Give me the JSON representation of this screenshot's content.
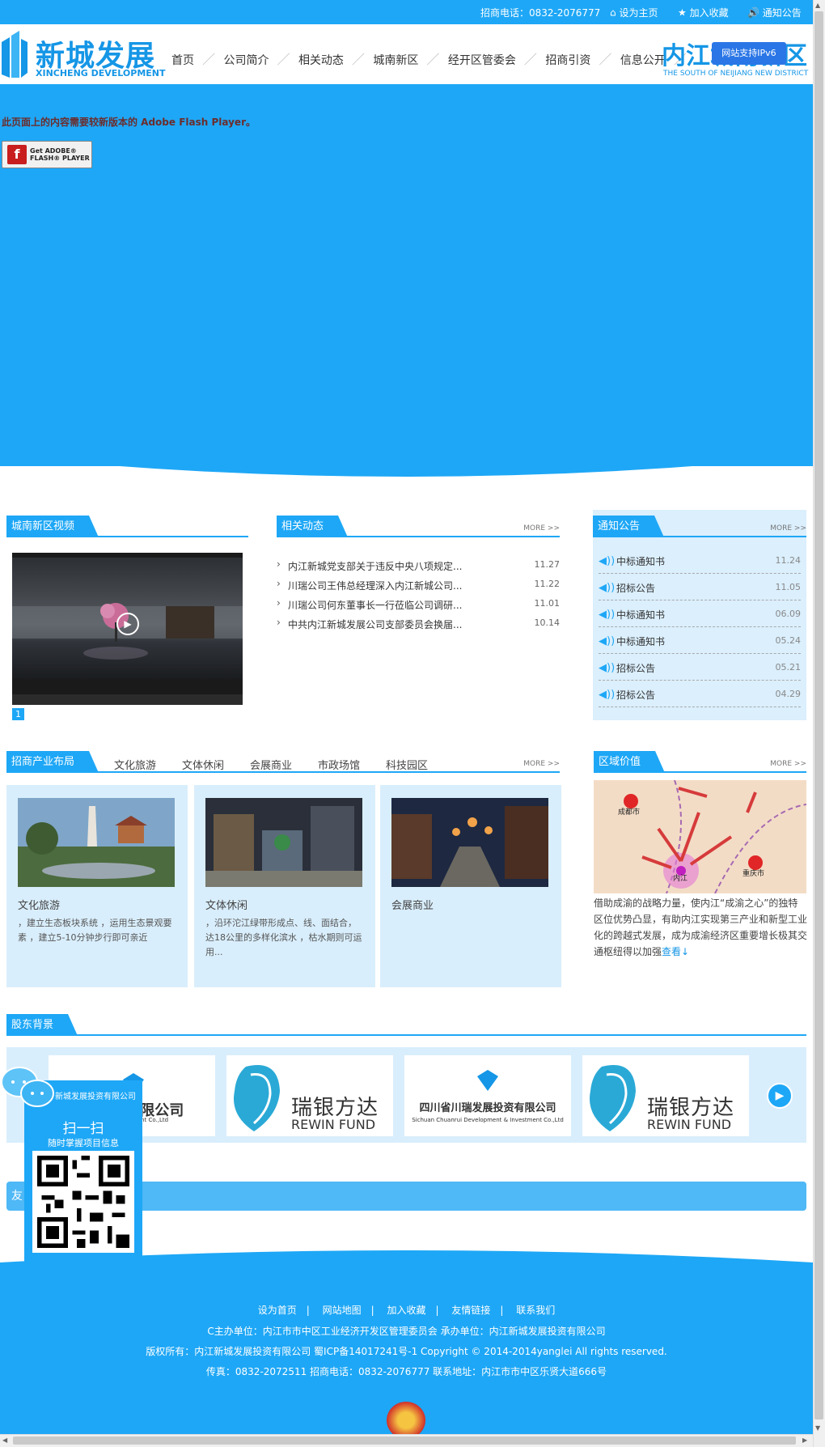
{
  "topbar": {
    "phone": "招商电话：0832-2076777",
    "home": "设为主页",
    "favorite": "加入收藏",
    "notice": "通知公告"
  },
  "header": {
    "logo_cn": "新城发展",
    "logo_en": "XINCHENG DEVELOPMENT",
    "brand_right": "内江城南新区",
    "brand_right_en": "THE SOUTH OF NEIJIANG NEW DISTRICT",
    "ipv6": "网站支持IPv6",
    "nav": [
      "首页",
      "公司简介",
      "相关动态",
      "城南新区",
      "经开区管委会",
      "招商引资",
      "信息公开"
    ]
  },
  "banner": {
    "flash_msg": "此页面上的内容需要较新版本的 Adobe Flash Player。",
    "flash_btn_line1": "Get ADOBE®",
    "flash_btn_line2": "FLASH® PLAYER"
  },
  "video": {
    "title": "城南新区视频",
    "page": "1"
  },
  "news": {
    "title": "相关动态",
    "more": "MORE >>",
    "items": [
      {
        "title": "内江新城党支部关于违反中央八项规定...",
        "date": "11.27"
      },
      {
        "title": "川瑞公司王伟总经理深入内江新城公司...",
        "date": "11.22"
      },
      {
        "title": "川瑞公司何东董事长一行莅临公司调研...",
        "date": "11.01"
      },
      {
        "title": "中共内江新城发展公司支部委员会换届...",
        "date": "10.14"
      }
    ]
  },
  "notices": {
    "title": "通知公告",
    "more": "MORE >>",
    "items": [
      {
        "title": "中标通知书",
        "date": "11.24"
      },
      {
        "title": "招标公告",
        "date": "11.05"
      },
      {
        "title": "中标通知书",
        "date": "06.09"
      },
      {
        "title": "中标通知书",
        "date": "05.24"
      },
      {
        "title": "招标公告",
        "date": "05.21"
      },
      {
        "title": "招标公告",
        "date": "04.29"
      }
    ]
  },
  "industry": {
    "title": "招商产业布局",
    "more": "MORE >>",
    "tabs": [
      "文化旅游",
      "文体休闲",
      "会展商业",
      "市政场馆",
      "科技园区"
    ],
    "cards": [
      {
        "title": "文化旅游",
        "desc": "，建立生态板块系统 ，运用生态景观要素 ，建立5-10分钟步行即可亲近"
      },
      {
        "title": "文体休闲",
        "desc": "，沿环沱江绿带形成点、线、面结合，达18公里的多样化滨水 ，枯水期则可运用..."
      },
      {
        "title": "会展商业",
        "desc": ""
      }
    ]
  },
  "region": {
    "title": "区域价值",
    "more": "MORE >>",
    "text": "借助成渝的战略力量，使内江“成渝之心”的独特区位优势凸显，有助内江实现第三产业和新型工业化的跨越式发展，成为成渝经济区重要增长极其交通枢纽得以加强",
    "link": "查看",
    "map_cities": [
      "成都市",
      "内江",
      "重庆市"
    ]
  },
  "shareholders": {
    "title": "股东背景",
    "items": [
      {
        "cn": "...投资有限公司",
        "en": "...nt & Investment Co.,Ltd"
      },
      {
        "cn": "瑞银方达",
        "en": "REWIN FUND"
      },
      {
        "cn": "四川省川瑞发展投资有限公司",
        "en": "Sichuan Chuanrui Development & Investment Co.,Ltd"
      },
      {
        "cn": "瑞银方达",
        "en": "REWIN FUND"
      }
    ]
  },
  "friend_links": {
    "title": "友"
  },
  "qr": {
    "company": "新城发展投资有限公司",
    "scan": "扫一扫",
    "sub": "随时掌握项目信息"
  },
  "footer": {
    "links": [
      "设为首页",
      "网站地图",
      "加入收藏",
      "友情链接",
      "联系我们"
    ],
    "sep": "|",
    "line1": "C主办单位：内江市市中区工业经济开发区管理委员会 承办单位：内江新城发展投资有限公司",
    "line2": "版权所有：内江新城发展投资有限公司 蜀ICP备14017241号-1    Copyright © 2014-2014yanglei All rights reserved.",
    "line3": "传真：0832-2072511 招商电话：0832-2076777 联系地址：内江市市中区乐贤大道666号"
  },
  "colors": {
    "primary": "#1ea7f6",
    "panel": "#d9eefc",
    "ipv6": "#2a76e6"
  }
}
